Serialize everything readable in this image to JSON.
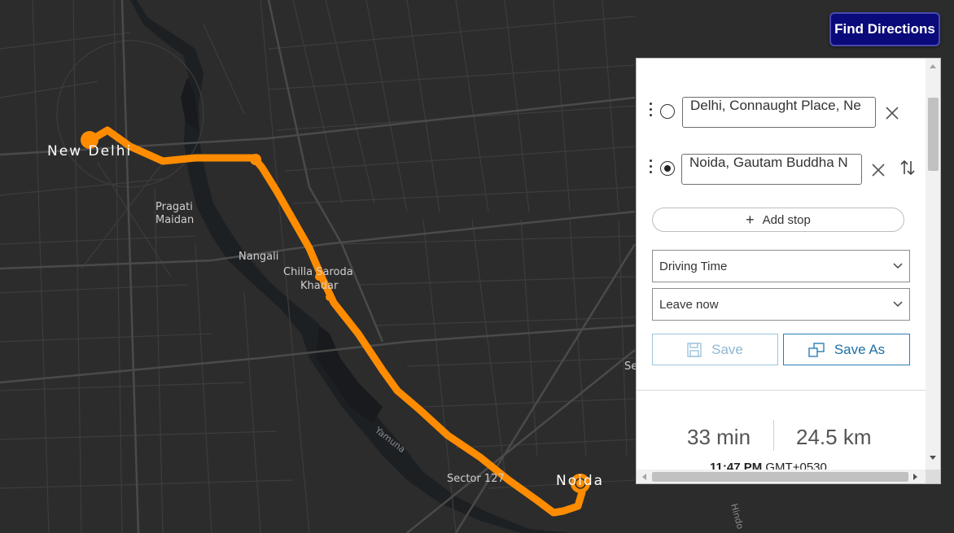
{
  "map": {
    "places": {
      "new_delhi": "New Delhi",
      "pragati_maidan_1": "Pragati",
      "pragati_maidan_2": "Maidan",
      "nangali": "Nangali",
      "chilla_1": "Chilla Saroda",
      "chilla_2": "Khadar",
      "sector_127": "Sector 127",
      "noida": "Noida",
      "river": "Yamuna",
      "edge_se": "Se",
      "edge_hindon": "Hindo"
    },
    "route_color": "#ff8c00",
    "background_color": "#2b2b2b",
    "road_color": "#444444",
    "water_color": "#1e2124"
  },
  "toolbar": {
    "find_directions_label": "Find Directions"
  },
  "directions": {
    "origin_value": "Delhi, Connaught Place, Ne",
    "destination_value": "Noida, Gautam Buddha N",
    "add_stop_label": "Add stop",
    "travel_mode": "Driving Time",
    "departure": "Leave now",
    "save_label": "Save",
    "save_as_label": "Save As",
    "summary_time": "33 min",
    "summary_distance": "24.5 km",
    "arrival_time": "11:47 PM",
    "arrival_tz": "GMT+0530"
  },
  "icons": {
    "drag": "drag-handle-icon",
    "origin_marker": "radio-empty-icon",
    "destination_marker": "radio-filled-icon",
    "remove": "close-icon",
    "swap": "swap-arrows-icon",
    "add": "plus-icon",
    "dropdown": "chevron-down-icon",
    "save": "floppy-disk-icon",
    "save_as": "copy-icon"
  }
}
